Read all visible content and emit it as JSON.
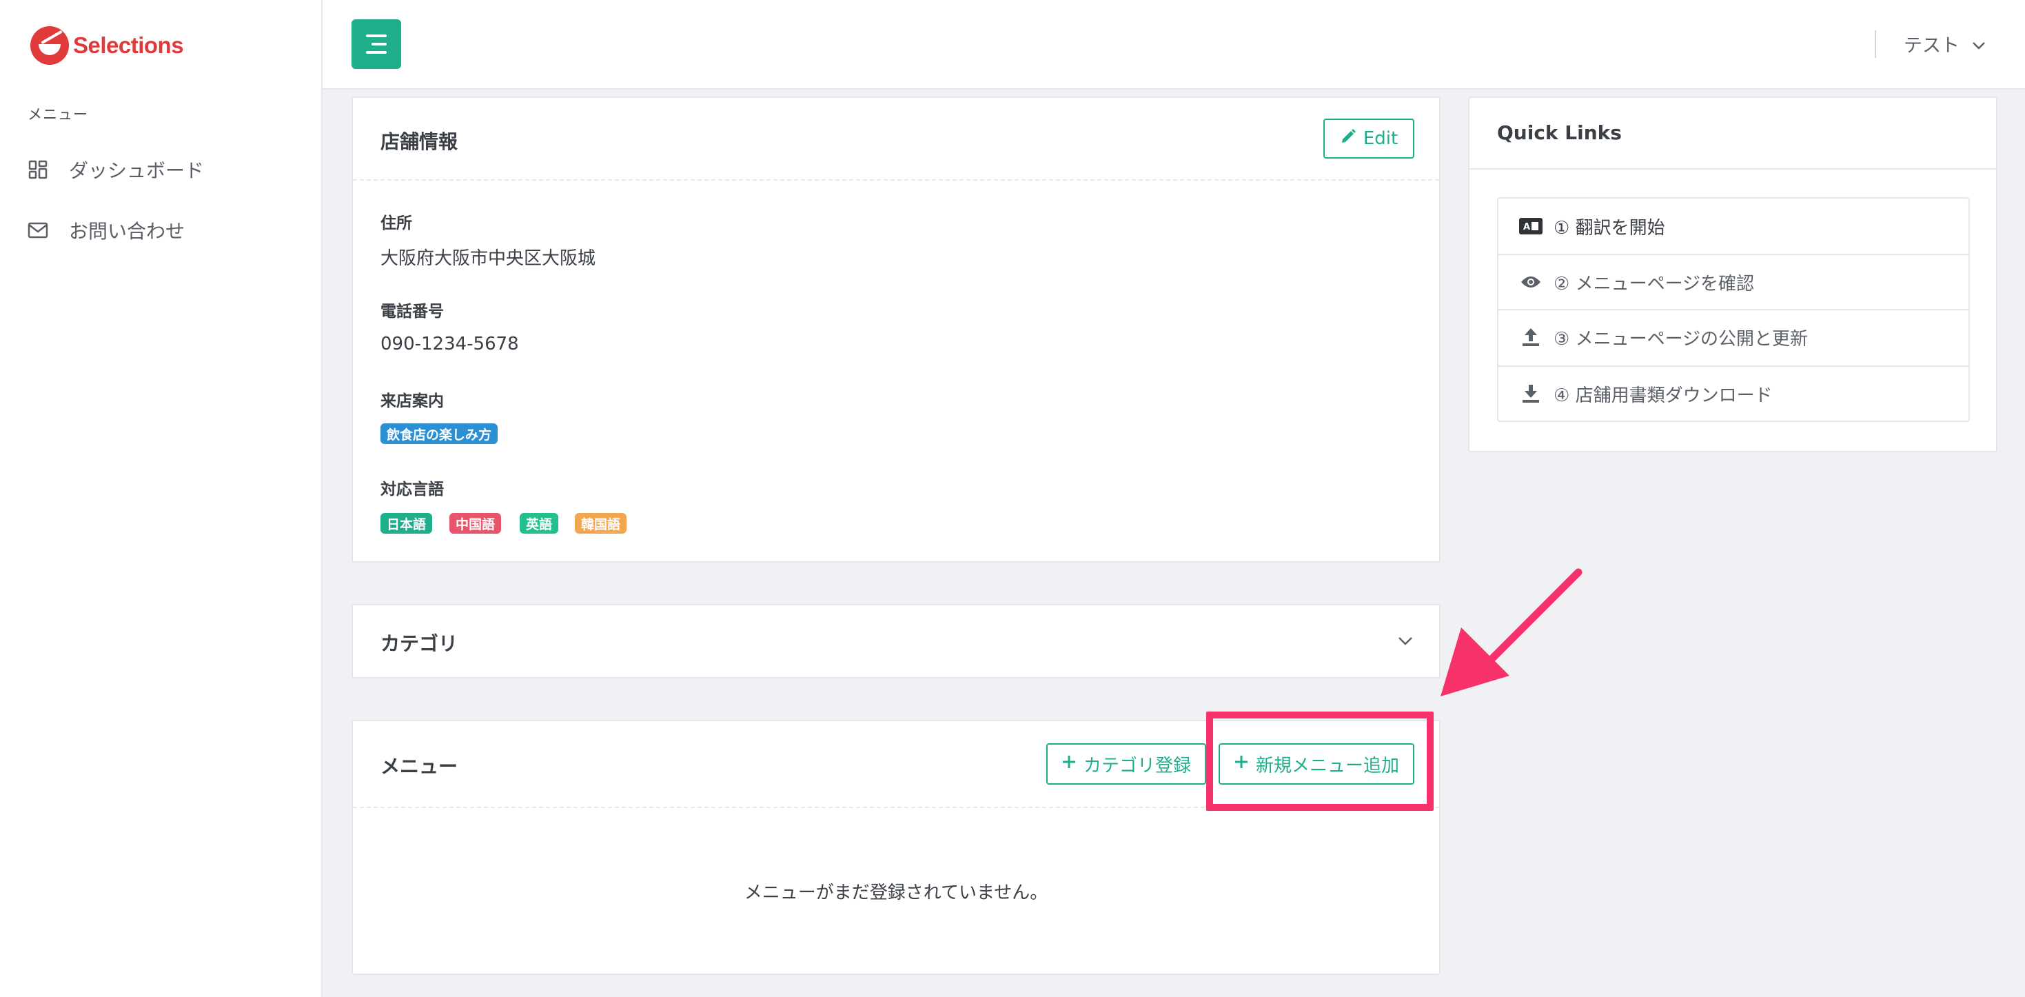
{
  "app": {
    "logo_text": "Selections"
  },
  "sidebar": {
    "heading": "メニュー",
    "items": [
      {
        "label": "ダッシュボード",
        "icon": "dashboard-grid-icon"
      },
      {
        "label": "お問い合わせ",
        "icon": "envelope-icon"
      }
    ]
  },
  "header": {
    "user_name": "テスト"
  },
  "store_info": {
    "title": "店舗情報",
    "edit_label": "Edit",
    "address_label": "住所",
    "address_value": "大阪府大阪市中央区大阪城",
    "phone_label": "電話番号",
    "phone_value": "090-1234-5678",
    "guide_label": "来店案内",
    "guide_badge": "飲食店の楽しみ方",
    "languages_label": "対応言語",
    "languages": [
      {
        "label": "日本語",
        "color": "#1fae8c"
      },
      {
        "label": "中国語",
        "color": "#e8546a"
      },
      {
        "label": "英語",
        "color": "#22c08f"
      },
      {
        "label": "韓国語",
        "color": "#f2a650"
      }
    ],
    "guide_badge_color": "#2b8fd4"
  },
  "quick_links": {
    "title": "Quick Links",
    "items": [
      {
        "label": "① 翻訳を開始",
        "icon": "translate-icon"
      },
      {
        "label": "② メニューページを確認",
        "icon": "eye-icon"
      },
      {
        "label": "③ メニューページの公開と更新",
        "icon": "upload-icon"
      },
      {
        "label": "④ 店舗用書類ダウンロード",
        "icon": "download-icon"
      }
    ]
  },
  "category": {
    "title": "カテゴリ"
  },
  "menu": {
    "title": "メニュー",
    "add_category_label": "カテゴリ登録",
    "add_menu_label": "新規メニュー追加",
    "empty_message": "メニューがまだ登録されていません。"
  },
  "colors": {
    "accent": "#1fae8c",
    "brand": "#e03a3a",
    "highlight": "#f7326b"
  }
}
